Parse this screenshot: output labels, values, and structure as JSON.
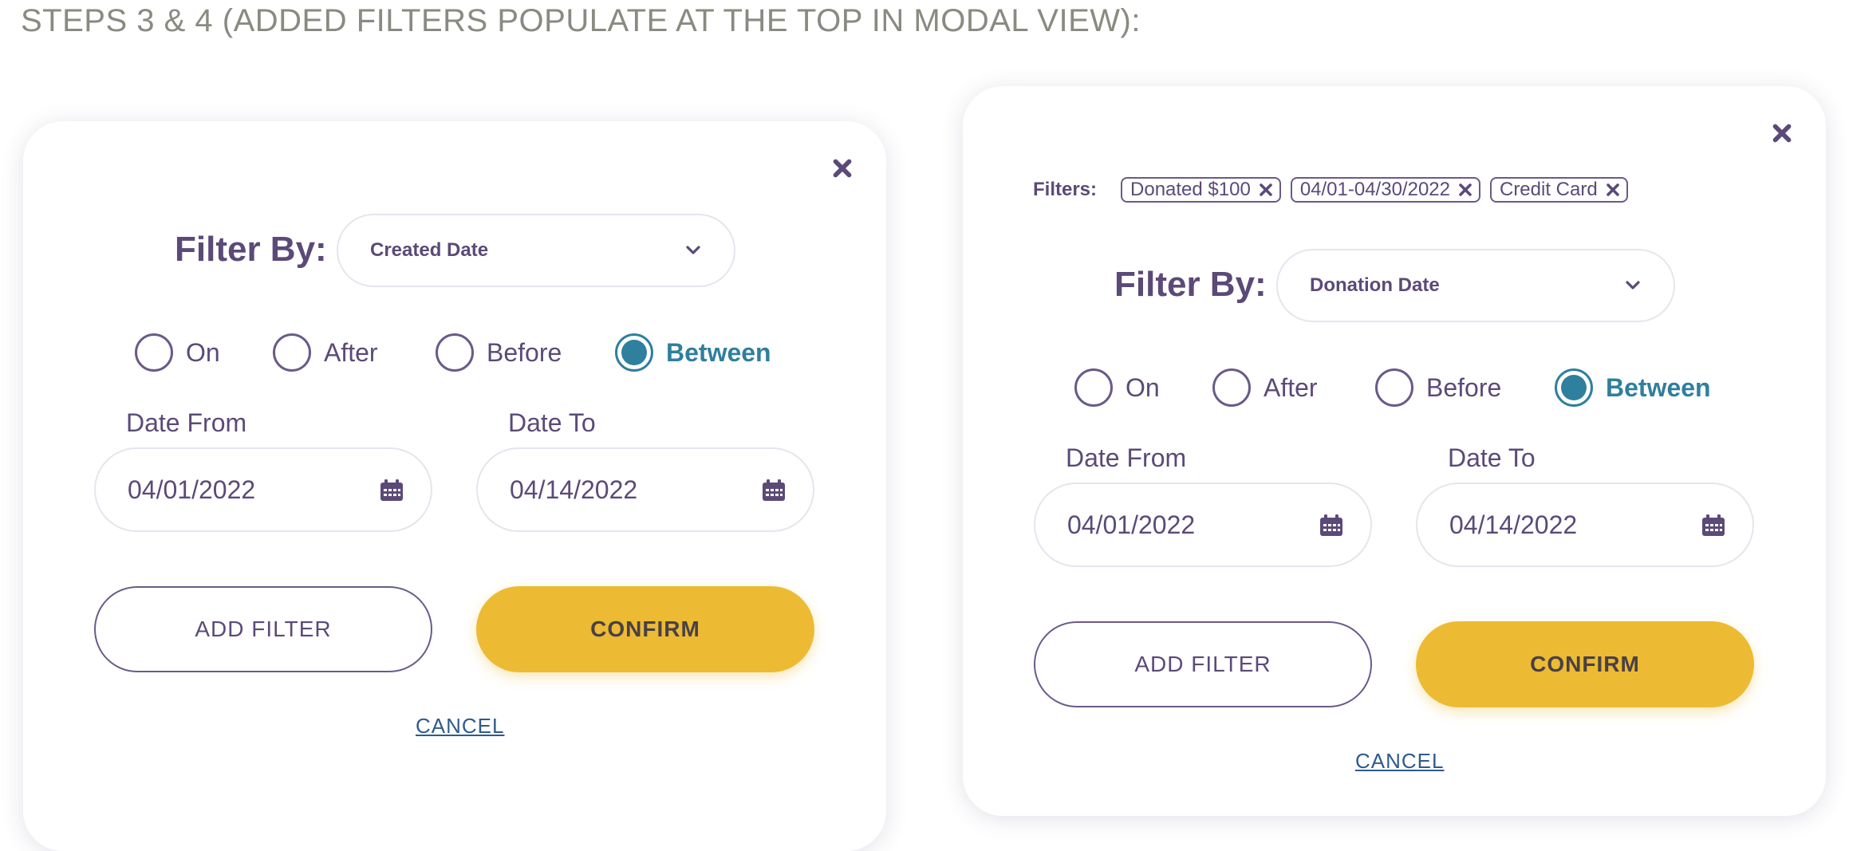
{
  "page": {
    "heading": "STEPS 3 & 4 (ADDED FILTERS POPULATE AT THE TOP IN MODAL VIEW):"
  },
  "modals": [
    {
      "filter_by_label": "Filter By:",
      "select_value": "Created Date",
      "radio_options": [
        "On",
        "After",
        "Before",
        "Between"
      ],
      "selected_option": "Between",
      "date_from": {
        "label": "Date From",
        "value": "04/01/2022"
      },
      "date_to": {
        "label": "Date To",
        "value": "04/14/2022"
      },
      "add_filter_label": "ADD FILTER",
      "confirm_label": "CONFIRM",
      "cancel_label": "CANCEL"
    },
    {
      "filters_label": "Filters:",
      "filter_chips": [
        "Donated $100",
        "04/01-04/30/2022",
        "Credit Card"
      ],
      "filter_by_label": "Filter By:",
      "select_value": "Donation Date",
      "radio_options": [
        "On",
        "After",
        "Before",
        "Between"
      ],
      "selected_option": "Between",
      "date_from": {
        "label": "Date From",
        "value": "04/01/2022"
      },
      "date_to": {
        "label": "Date To",
        "value": "04/14/2022"
      },
      "add_filter_label": "ADD FILTER",
      "confirm_label": "CONFIRM",
      "cancel_label": "CANCEL"
    }
  ],
  "icons": {
    "close": "close-icon",
    "chevron": "chevron-down-icon",
    "calendar": "calendar-icon",
    "chip_remove": "remove-filter-icon"
  },
  "colors": {
    "text_primary": "#5b4a78",
    "accent_selected": "#2f7f9e",
    "confirm_button": "#ecbb33",
    "cancel_link": "#2f5a8e",
    "heading_gray": "#8a8a82"
  }
}
